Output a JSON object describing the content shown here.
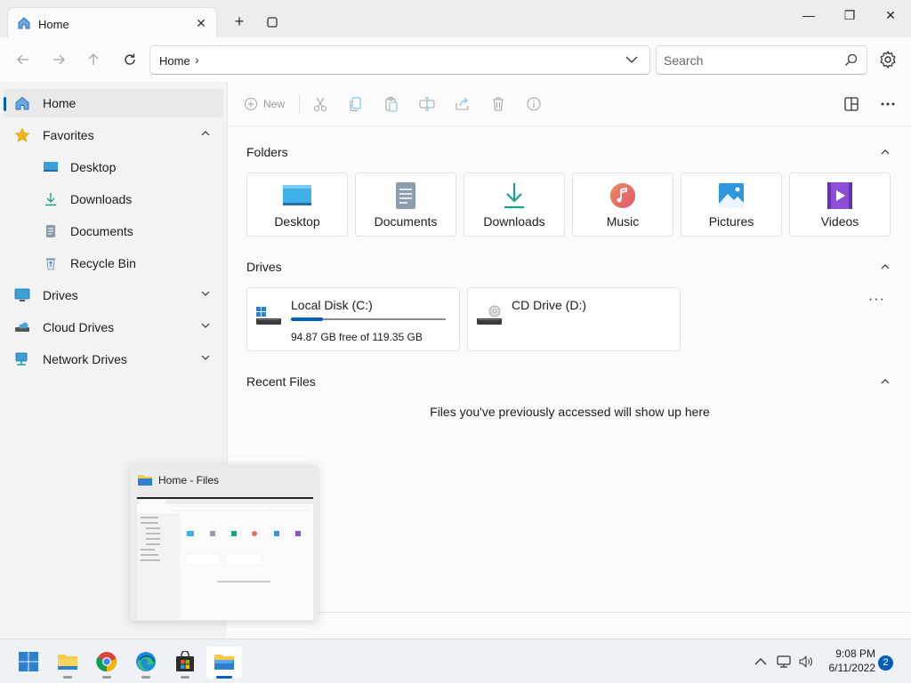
{
  "tab": {
    "title": "Home",
    "close": "✕"
  },
  "tabbar": {
    "new_tab": "+"
  },
  "window": {
    "minimize": "—",
    "maximize": "❐",
    "close": "✕"
  },
  "address": {
    "crumb": "Home",
    "separator": "›"
  },
  "search": {
    "placeholder": "Search"
  },
  "sidebar": {
    "items": [
      {
        "label": "Home",
        "icon": "home-icon",
        "selected": true
      },
      {
        "label": "Favorites",
        "icon": "star-icon",
        "expanded": true
      },
      {
        "label": "Desktop",
        "icon": "desktop-icon"
      },
      {
        "label": "Downloads",
        "icon": "download-icon"
      },
      {
        "label": "Documents",
        "icon": "document-icon"
      },
      {
        "label": "Recycle Bin",
        "icon": "recycle-bin-icon"
      },
      {
        "label": "Drives",
        "icon": "monitor-icon",
        "expanded": false
      },
      {
        "label": "Cloud Drives",
        "icon": "cloud-drive-icon",
        "expanded": false
      },
      {
        "label": "Network Drives",
        "icon": "network-icon",
        "expanded": false
      }
    ]
  },
  "toolbar": {
    "new_label": "New"
  },
  "sections": {
    "folders": "Folders",
    "drives": "Drives",
    "recent": "Recent Files"
  },
  "folders": [
    {
      "label": "Desktop",
      "icon": "desktop-icon"
    },
    {
      "label": "Documents",
      "icon": "documents-icon"
    },
    {
      "label": "Downloads",
      "icon": "downloads-icon"
    },
    {
      "label": "Music",
      "icon": "music-icon"
    },
    {
      "label": "Pictures",
      "icon": "pictures-icon"
    },
    {
      "label": "Videos",
      "icon": "videos-icon"
    }
  ],
  "drives": [
    {
      "name": "Local Disk (C:)",
      "free_text": "94.87 GB free of 119.35 GB",
      "used_fraction": 0.205
    },
    {
      "name": "CD Drive (D:)"
    }
  ],
  "drives_more": "···",
  "recent": {
    "empty_message": "Files you've previously accessed will show up here"
  },
  "preview": {
    "title": "Home - Files"
  },
  "clock": {
    "time": "9:08 PM",
    "date": "6/11/2022"
  },
  "notifications": {
    "count": "2"
  },
  "colors": {
    "accent": "#005fb8",
    "folder_yellow": "#f7c948"
  }
}
